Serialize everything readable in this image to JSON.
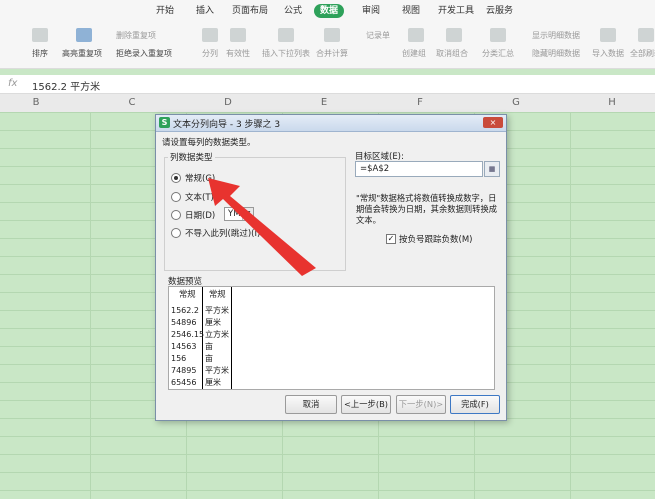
{
  "menubar": {
    "tabs": [
      "开始",
      "插入",
      "页面布局",
      "公式",
      "数据",
      "审阅",
      "视图",
      "开发工具",
      "云服务"
    ],
    "active": "数据"
  },
  "ribbon": {
    "items": [
      {
        "label": "排序",
        "style": ""
      },
      {
        "label": "高亮重复项",
        "style": ""
      },
      {
        "label": "删除重复项",
        "style": "gray"
      },
      {
        "label": "拒绝录入重复项",
        "style": ""
      },
      {
        "label": "分列",
        "style": "gray"
      },
      {
        "label": "有效性",
        "style": "gray"
      },
      {
        "label": "插入下拉列表",
        "style": "gray"
      },
      {
        "label": "合并计算",
        "style": "gray"
      },
      {
        "label": "记录单",
        "style": "gray"
      },
      {
        "label": "创建组",
        "style": "gray"
      },
      {
        "label": "取消组合",
        "style": "gray"
      },
      {
        "label": "分类汇总",
        "style": "gray"
      },
      {
        "label": "显示明细数据",
        "style": "gray"
      },
      {
        "label": "隐藏明细数据",
        "style": "gray"
      },
      {
        "label": "导入数据",
        "style": "gray"
      },
      {
        "label": "全部刷新",
        "style": "gray"
      }
    ]
  },
  "formula_bar": {
    "fx": "fx",
    "value": "1562.2 平方米"
  },
  "columns": [
    "B",
    "C",
    "D",
    "E",
    "F",
    "G",
    "H"
  ],
  "dialog": {
    "title": "文本分列向导 - 3 步骤之 3",
    "close": "×",
    "prompt": "请设置每列的数据类型。",
    "group_title": "列数据类型",
    "radios": [
      {
        "label": "常规(G)",
        "checked": true
      },
      {
        "label": "文本(T)",
        "checked": false
      },
      {
        "label": "日期(D)",
        "checked": false
      },
      {
        "label": "不导入此列(跳过)(I)",
        "checked": false
      }
    ],
    "date_format": "YMD",
    "target_label": "目标区域(E):",
    "target_value": "=$A$2",
    "note": "\"常规\"数据格式将数值转换成数字，日期值会转换为日期，其余数据则转换成文本。",
    "checkbox_label": "按负号跟踪负数(M)",
    "checkbox_checked": true,
    "preview_label": "数据预览",
    "preview_headers": [
      "常规",
      "常规"
    ],
    "preview_rows": [
      [
        "1562.2",
        "平方米"
      ],
      [
        "54896",
        "厘米"
      ],
      [
        "2546.15",
        "立方米"
      ],
      [
        "14563",
        "亩"
      ],
      [
        "156",
        "亩"
      ],
      [
        "74895",
        "平方米"
      ],
      [
        "65456",
        "厘米"
      ]
    ],
    "buttons": {
      "cancel": "取消",
      "back": "<上一步(B)",
      "next": "下一步(N)>",
      "finish": "完成(F)"
    }
  },
  "colors": {
    "accent": "#2ea15a",
    "sheet": "#c9e7c6",
    "arrow": "#e8332f"
  }
}
